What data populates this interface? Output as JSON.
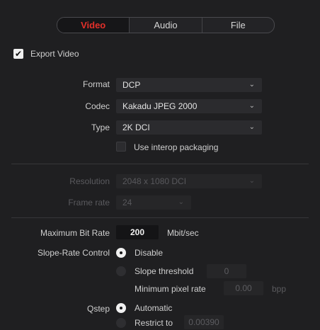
{
  "tabs": [
    {
      "label": "Video",
      "active": true
    },
    {
      "label": "Audio",
      "active": false
    },
    {
      "label": "File",
      "active": false
    }
  ],
  "export_video": {
    "label": "Export Video",
    "checked": true
  },
  "format": {
    "label": "Format",
    "value": "DCP"
  },
  "codec": {
    "label": "Codec",
    "value": "Kakadu JPEG 2000"
  },
  "type": {
    "label": "Type",
    "value": "2K DCI"
  },
  "interop": {
    "label": "Use interop packaging",
    "checked": false
  },
  "resolution": {
    "label": "Resolution",
    "value": "2048 x 1080 DCI"
  },
  "frame_rate": {
    "label": "Frame rate",
    "value": "24"
  },
  "max_bit_rate": {
    "label": "Maximum Bit Rate",
    "value": "200",
    "unit": "Mbit/sec"
  },
  "slope_rate": {
    "label": "Slope-Rate Control",
    "option_disable": "Disable",
    "option_threshold": "Slope threshold",
    "threshold_value": "0",
    "min_pixel_label": "Minimum pixel rate",
    "min_pixel_value": "0.00",
    "min_pixel_unit": "bpp",
    "selected": "Disable"
  },
  "qstep": {
    "label": "Qstep",
    "option_auto": "Automatic",
    "option_restrict": "Restrict to",
    "restrict_value": "0.00390",
    "selected": "Automatic"
  },
  "colors": {
    "accent_red": "#e3302a",
    "background": "#1f1f21"
  }
}
